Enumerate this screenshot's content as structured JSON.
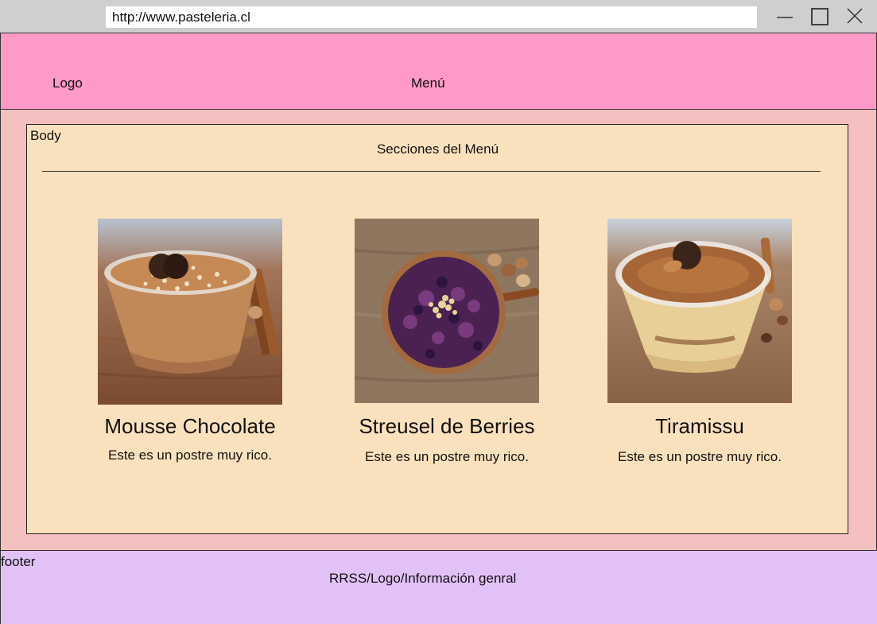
{
  "browser": {
    "url": "http://www.pasteleria.cl",
    "minimize_icon": "minimize-icon",
    "maximize_icon": "maximize-icon",
    "close_icon": "close-icon"
  },
  "header": {
    "logo": "Logo",
    "menu": "Menú",
    "background": "#ff99c8"
  },
  "body": {
    "label": "Body",
    "section_title": "Secciones del Menú",
    "background": "#fae1be",
    "cards": [
      {
        "title": "Mousse Chocolate",
        "description": "Este es un postre muy rico.",
        "image": "mousse-chocolate-photo"
      },
      {
        "title": "Streusel de Berries",
        "description": "Este es un postre muy rico.",
        "image": "streusel-berries-photo"
      },
      {
        "title": "Tiramissu",
        "description": "Este es un postre muy rico.",
        "image": "tiramissu-photo"
      }
    ]
  },
  "footer": {
    "label": "footer",
    "info": "RRSS/Logo/Información genral",
    "background": "#e2c1f6"
  },
  "page_background": "#f4bfbf"
}
